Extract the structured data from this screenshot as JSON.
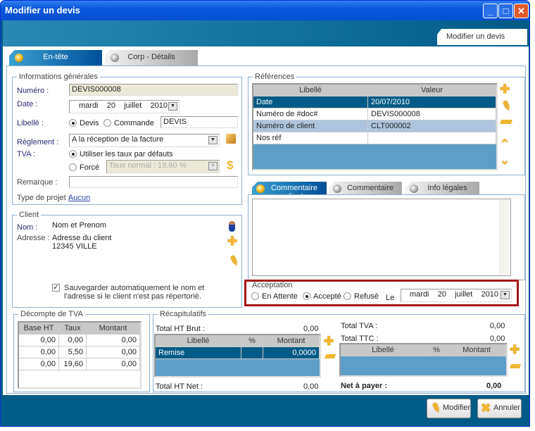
{
  "window": {
    "title": "Modifier un devis",
    "header_tab": "Modifier un devis"
  },
  "tabs": [
    {
      "label": "En-tête",
      "active": true
    },
    {
      "label": "Corp - Détails",
      "active": false
    }
  ],
  "info": {
    "legend": "Informations générales",
    "numero_label": "Numéro :",
    "numero": "DEVIS000008",
    "date_label": "Date :",
    "date": {
      "day": "mardi",
      "num": "20",
      "month": "juillet",
      "year": "2010"
    },
    "libelle_label": "Libellé :",
    "libelle_opt1": "Devis",
    "libelle_opt2": "Commande",
    "libelle_value": "DEVIS",
    "reglement_label": "Règlement :",
    "reglement": "A la réception de la facture",
    "tva_label": "TVA :",
    "tva_opt1": "Utiliser les taux par défauts",
    "tva_opt2": "Forcé",
    "tva_forced": "Taux normal : 19,60  %",
    "remarque_label": "Remarque :",
    "remarque": "",
    "projet_label": "Type de projet :",
    "projet_link": "Aucun"
  },
  "client": {
    "legend": "Client",
    "nom_label": "Nom :",
    "nom": "Nom et Prenom",
    "adresse_label": "Adresse :",
    "adresse1": "Adresse du client",
    "adresse2": "12345 VILLE",
    "save_line1": "Sauvegarder automatiquement le nom et",
    "save_line2": "l'adresse si le client n'est pas répertorié.",
    "save_checked": true
  },
  "references": {
    "legend": "Références",
    "headers": [
      "Libellé",
      "Valeur"
    ],
    "rows": [
      [
        "Date",
        "20/07/2010"
      ],
      [
        "Numéro de #doc#",
        "DEVIS000008"
      ],
      [
        "Numéro de client",
        "CLT000002"
      ],
      [
        "Nos réf",
        ""
      ]
    ]
  },
  "comment_tabs": [
    {
      "label": "Commentaire client"
    },
    {
      "label": "Commentaire perso"
    },
    {
      "label": "Info légales"
    }
  ],
  "acceptation": {
    "legend": "Acceptation",
    "opt1": "En Attente",
    "opt2": "Accepté",
    "opt3": "Refusé",
    "le": "Le",
    "date": {
      "day": "mardi",
      "num": "20",
      "month": "juillet",
      "year": "2010"
    }
  },
  "tva_count": {
    "legend": "Décompte de TVA",
    "headers": [
      "Base HT",
      "Taux",
      "Montant"
    ],
    "rows": [
      [
        "0,00",
        "0,00",
        "0,00"
      ],
      [
        "0,00",
        "5,50",
        "0,00"
      ],
      [
        "0,00",
        "19,60",
        "0,00"
      ]
    ]
  },
  "recap": {
    "legend": "Récapitulatifs",
    "brut_label": "Total HT Brut :",
    "brut": "0,00",
    "net_label": "Total HT Net :",
    "net": "0,00",
    "headers": [
      "Libellé",
      "%",
      "Montant"
    ],
    "remise": [
      "Remise",
      "",
      "0,0000"
    ],
    "tva_label": "Total TVA :",
    "tva": "0,00",
    "ttc_label": "Total TTC :",
    "ttc": "0,00",
    "payer_label": "Net à payer :",
    "payer": "0,00"
  },
  "buttons": {
    "modifier": "Modifier",
    "annuler": "Annuler"
  }
}
